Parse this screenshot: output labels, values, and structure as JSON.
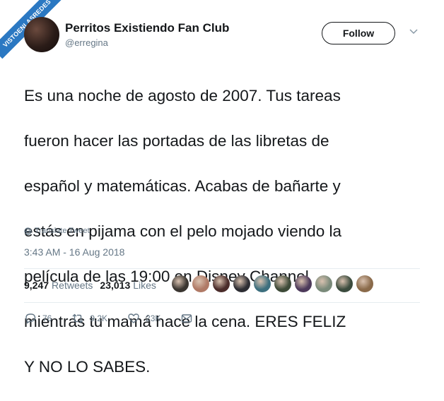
{
  "watermark": "VISTOENLASREDES",
  "user": {
    "display_name": "Perritos Existiendo Fan Club",
    "handle": "@erregina"
  },
  "follow_label": "Follow",
  "tweet": {
    "lines": [
      "Es una noche de agosto de 2007. Tus tareas",
      "fueron hacer las portadas de las libretas de",
      "español y matemáticas. Acabas de bañarte y",
      "estás en pijama con el pelo mojado viendo la",
      "película de las 19:00 en Disney Channel",
      "mientras tu mamá hace la cena. ERES FELIZ",
      "Y NO LO SABES."
    ],
    "translate_label": "Translate Tweet",
    "timestamp": "3:43 AM - 16 Aug 2018"
  },
  "stats": {
    "retweets_count": "9,247",
    "retweets_label": "Retweets",
    "likes_count": "23,013",
    "likes_label": "Likes"
  },
  "likers": [
    {
      "name": "liker-1",
      "color": "#3a3530"
    },
    {
      "name": "liker-2",
      "color": "#b07a66"
    },
    {
      "name": "liker-3",
      "color": "#4a2c2a"
    },
    {
      "name": "liker-4",
      "color": "#2d2d33"
    },
    {
      "name": "liker-5",
      "color": "#3d6f7e"
    },
    {
      "name": "liker-6",
      "color": "#3e4a38"
    },
    {
      "name": "liker-7",
      "color": "#4d3a5a"
    },
    {
      "name": "liker-8",
      "color": "#7a8a7a"
    },
    {
      "name": "liker-9",
      "color": "#3b4b3d"
    },
    {
      "name": "liker-10",
      "color": "#8a6a4a"
    }
  ],
  "actions": {
    "reply_count": "76",
    "retweet_count": "9.2K",
    "like_count": "23K"
  }
}
